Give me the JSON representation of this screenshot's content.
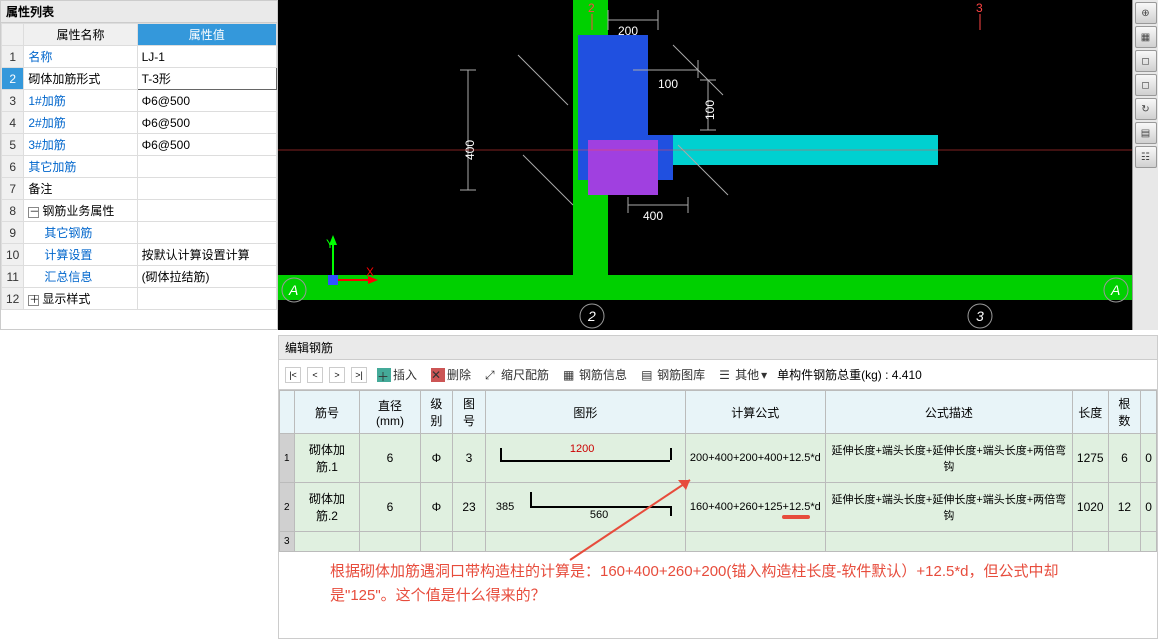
{
  "propPanel": {
    "title": "属性列表",
    "headers": {
      "name": "属性名称",
      "value": "属性值"
    },
    "rows": [
      {
        "n": "1",
        "name": "名称",
        "value": "LJ-1",
        "blue": true
      },
      {
        "n": "2",
        "name": "砌体加筋形式",
        "value": "T-3形",
        "sel": true
      },
      {
        "n": "3",
        "name": "1#加筋",
        "value": "Φ6@500",
        "blue": true
      },
      {
        "n": "4",
        "name": "2#加筋",
        "value": "Φ6@500",
        "blue": true
      },
      {
        "n": "5",
        "name": "3#加筋",
        "value": "Φ6@500",
        "blue": true
      },
      {
        "n": "6",
        "name": "其它加筋",
        "value": "",
        "blue": true
      },
      {
        "n": "7",
        "name": "备注",
        "value": ""
      },
      {
        "n": "8",
        "name": "钢筋业务属性",
        "value": "",
        "exp": "－"
      },
      {
        "n": "9",
        "name": "其它钢筋",
        "value": "",
        "blue": true,
        "indent": true
      },
      {
        "n": "10",
        "name": "计算设置",
        "value": "按默认计算设置计算",
        "indent": true
      },
      {
        "n": "11",
        "name": "汇总信息",
        "value": "(砌体拉结筋)",
        "indent": true
      },
      {
        "n": "12",
        "name": "显示样式",
        "value": "",
        "exp": "＋"
      }
    ]
  },
  "viewport": {
    "dims": {
      "d200": "200",
      "d100a": "100",
      "d100b": "100",
      "d400a": "400",
      "d400b": "400"
    },
    "axes": {
      "y": "Y",
      "x": "X"
    },
    "markers": {
      "a1": "A",
      "a2": "A",
      "n2": "2",
      "n3": "3",
      "top2": "2",
      "top3": "3"
    }
  },
  "toolIcons": [
    "⊕",
    "▦",
    "◻",
    "◻",
    "↻",
    "▤",
    "☷"
  ],
  "bottom": {
    "title": "编辑钢筋",
    "toolbar": {
      "insert": "插入",
      "delete": "删除",
      "scale": "缩尺配筋",
      "info": "钢筋信息",
      "lib": "钢筋图库",
      "other": "其他",
      "weight": "单构件钢筋总重(kg) : 4.410"
    },
    "headers": [
      "筋号",
      "直径(mm)",
      "级别",
      "图号",
      "图形",
      "计算公式",
      "公式描述",
      "长度",
      "根数",
      ""
    ],
    "rows": [
      {
        "rn": "1",
        "id": "砌体加筋.1",
        "dia": "6",
        "grade": "Φ",
        "fig": "3",
        "shape": {
          "main": "1200"
        },
        "formula": "200+400+200+400+12.5*d",
        "desc": "延伸长度+端头长度+延伸长度+端头长度+两倍弯钩",
        "len": "1275",
        "cnt": "6",
        "ext": "0"
      },
      {
        "rn": "2",
        "id": "砌体加筋.2",
        "dia": "6",
        "grade": "Φ",
        "fig": "23",
        "shape": {
          "left": "385",
          "main": "560"
        },
        "formula": "160+400+260+125+12.5*d",
        "desc": "延伸长度+端头长度+延伸长度+端头长度+两倍弯钩",
        "len": "1020",
        "cnt": "12",
        "ext": "0"
      },
      {
        "rn": "3"
      }
    ]
  },
  "annotation": "根据砌体加筋遇洞口带构造柱的计算是：160+400+260+200(锚入构造柱长度-软件默认）+12.5*d，但公式中却是\"125\"。这个值是什么得来的？",
  "chart_data": {
    "type": "diagram",
    "note": "CAD structural plan view of T-shaped masonry reinforcement joint",
    "dimensions_mm": [
      200,
      100,
      100,
      400,
      400
    ],
    "grid_axes": [
      "A",
      "2",
      "3"
    ],
    "elements": [
      "green-beam-horizontal",
      "green-beam-vertical",
      "blue-block",
      "purple-block",
      "cyan-block"
    ]
  }
}
